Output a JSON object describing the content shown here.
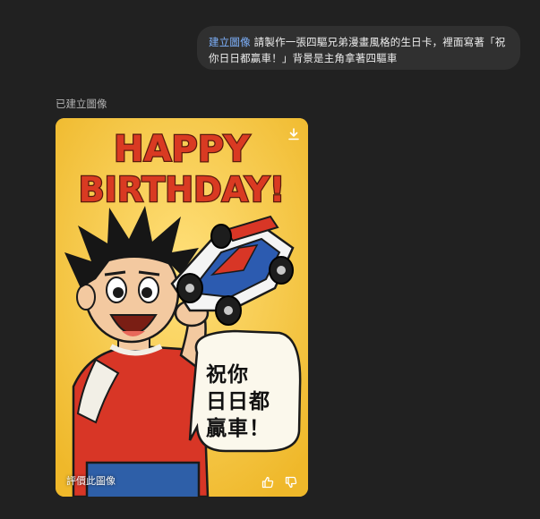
{
  "conversation": {
    "user_message": {
      "link_text": "建立圖像",
      "text": " 請製作一張四驅兄弟漫畫風格的生日卡，裡面寫著「祝你日日都贏車！」背景是主角拿著四驅車"
    },
    "status_label": "已建立圖像"
  },
  "image_card": {
    "headline_line1": "HAPPY",
    "headline_line2": "BIRTHDAY!",
    "speech_line1": "祝你",
    "speech_line2": "日日都",
    "speech_line3": "贏車！",
    "rate_label": "評價此圖像",
    "icons": {
      "download": "download-icon",
      "thumb_up": "thumbs-up-icon",
      "thumb_down": "thumbs-down-icon"
    }
  },
  "colors": {
    "background": "#212121",
    "bubble": "#303030",
    "link": "#7fb3ff",
    "card_yellow": "#f3c331",
    "headline_red": "#d93a22"
  }
}
